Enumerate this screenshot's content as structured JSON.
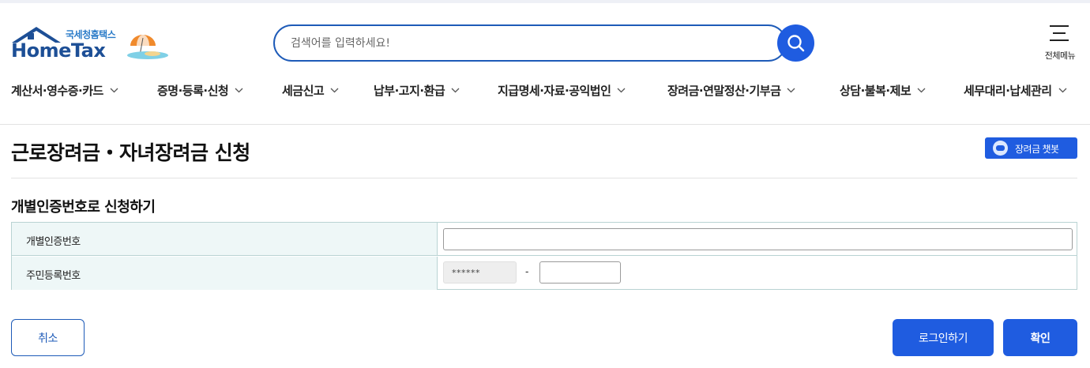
{
  "header": {
    "logo_sub": "국세청홈택스",
    "logo_main": "HomeTax",
    "search_placeholder": "검색어를 입력하세요!",
    "menu_label": "전체메뉴"
  },
  "nav": {
    "items": [
      {
        "label": "계산서·영수증·카드"
      },
      {
        "label": "증명·등록·신청"
      },
      {
        "label": "세금신고"
      },
      {
        "label": "납부·고지·환급"
      },
      {
        "label": "지급명세·자료·공익법인"
      },
      {
        "label": "장려금·연말정산·기부금"
      },
      {
        "label": "상담·불복·제보"
      },
      {
        "label": "세무대리·납세관리"
      }
    ]
  },
  "page": {
    "title": "근로장려금・자녀장려금 신청",
    "chatbot_label": "장려금 챗봇"
  },
  "form": {
    "section_title": "개별인증번호로 신청하기",
    "cert_label": "개별인증번호",
    "cert_value": "",
    "rrn_label": "주민등록번호",
    "rrn_front": "******",
    "rrn_dash": "-",
    "rrn_back": ""
  },
  "buttons": {
    "cancel": "취소",
    "login": "로그인하기",
    "confirm": "확인"
  },
  "colors": {
    "accent": "#1f5ce0",
    "border_blue": "#1e5bb8",
    "table_header_bg": "#eef7f7",
    "table_border": "#b9d3d3"
  }
}
